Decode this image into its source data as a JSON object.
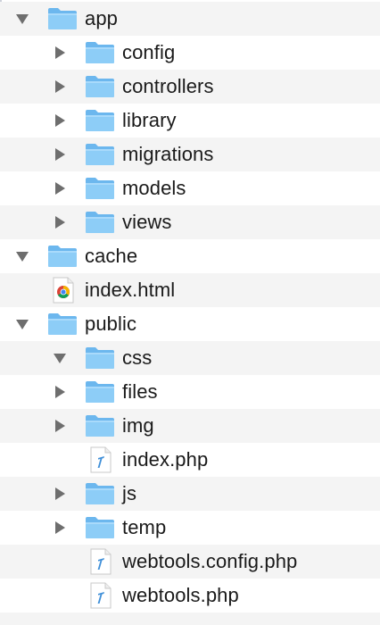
{
  "tree": {
    "rows": [
      {
        "label": "app"
      },
      {
        "label": "config"
      },
      {
        "label": "controllers"
      },
      {
        "label": "library"
      },
      {
        "label": "migrations"
      },
      {
        "label": "models"
      },
      {
        "label": "views"
      },
      {
        "label": "cache"
      },
      {
        "label": "index.html"
      },
      {
        "label": "public"
      },
      {
        "label": "css"
      },
      {
        "label": "files"
      },
      {
        "label": "img"
      },
      {
        "label": "index.php"
      },
      {
        "label": "js"
      },
      {
        "label": "temp"
      },
      {
        "label": "webtools.config.php"
      },
      {
        "label": "webtools.php"
      }
    ]
  },
  "colors": {
    "folder": "#7ec4f5",
    "folder_tab": "#a6d6f8",
    "stripe": "#f4f4f4",
    "disclosure": "#6e6e6e"
  },
  "icons": {
    "folder": "folder-icon",
    "html_file": "chrome-html-file-icon",
    "php_file": "php-file-icon"
  }
}
